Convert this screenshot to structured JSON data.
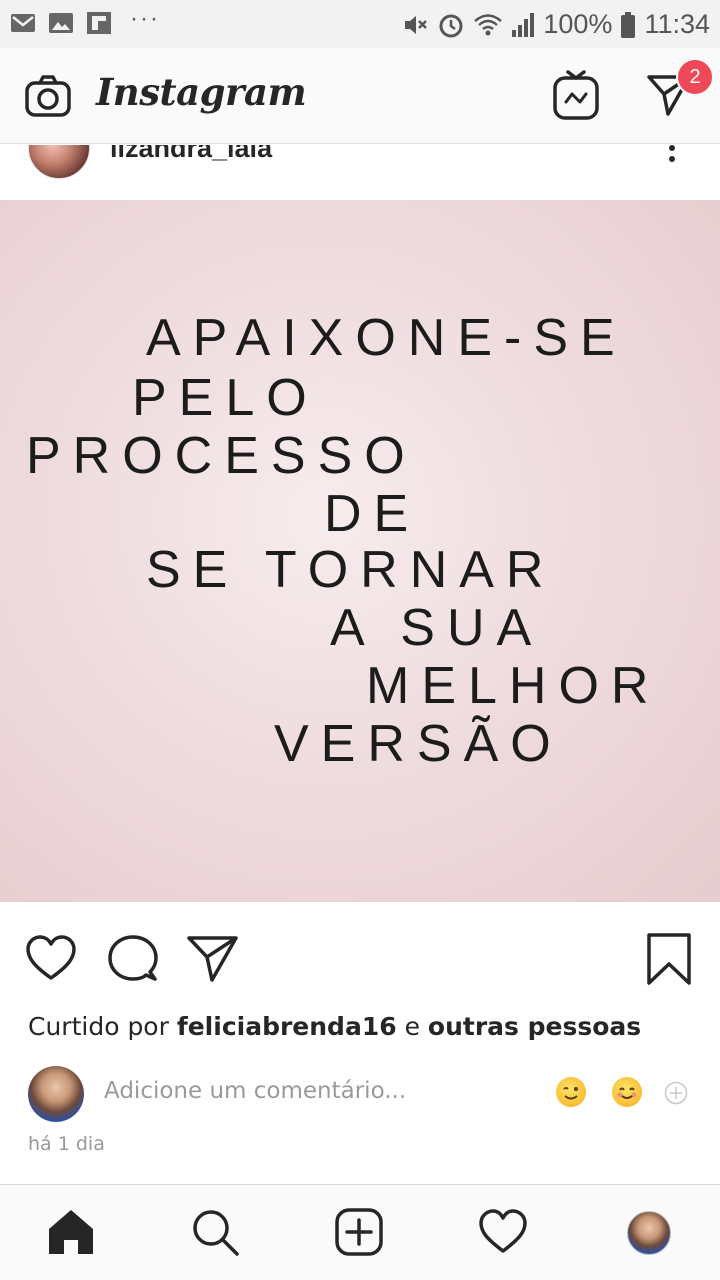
{
  "status_bar": {
    "battery_percent": "100%",
    "time": "11:34",
    "overflow": "···"
  },
  "header": {
    "logo_text": "Instagram",
    "direct_badge_count": "2"
  },
  "post": {
    "username": "lizandra_lala",
    "image_text_lines": [
      "APAIXONE-SE",
      "PELO",
      "PROCESSO",
      "DE",
      "SE TORNAR",
      "A SUA",
      "MELHOR",
      "VERSÃO"
    ],
    "likes_prefix": "Curtido por",
    "likes_user": "feliciabrenda16",
    "likes_joiner": "e",
    "likes_others": "outras pessoas",
    "comment_placeholder": "Adicione um comentário...",
    "timestamp": "há 1 dia"
  },
  "colors": {
    "accent_badge": "#ed4956",
    "text_primary": "#262626",
    "text_secondary": "#999999",
    "image_background": "#efdcdf"
  },
  "icons": {
    "header": [
      "camera-icon",
      "igtv-icon",
      "direct-message-icon"
    ],
    "actions": [
      "heart-icon",
      "comment-icon",
      "share-icon",
      "bookmark-icon"
    ],
    "bottom_nav": [
      "home-icon",
      "search-icon",
      "add-post-icon",
      "activity-heart-icon",
      "profile-avatar"
    ]
  }
}
